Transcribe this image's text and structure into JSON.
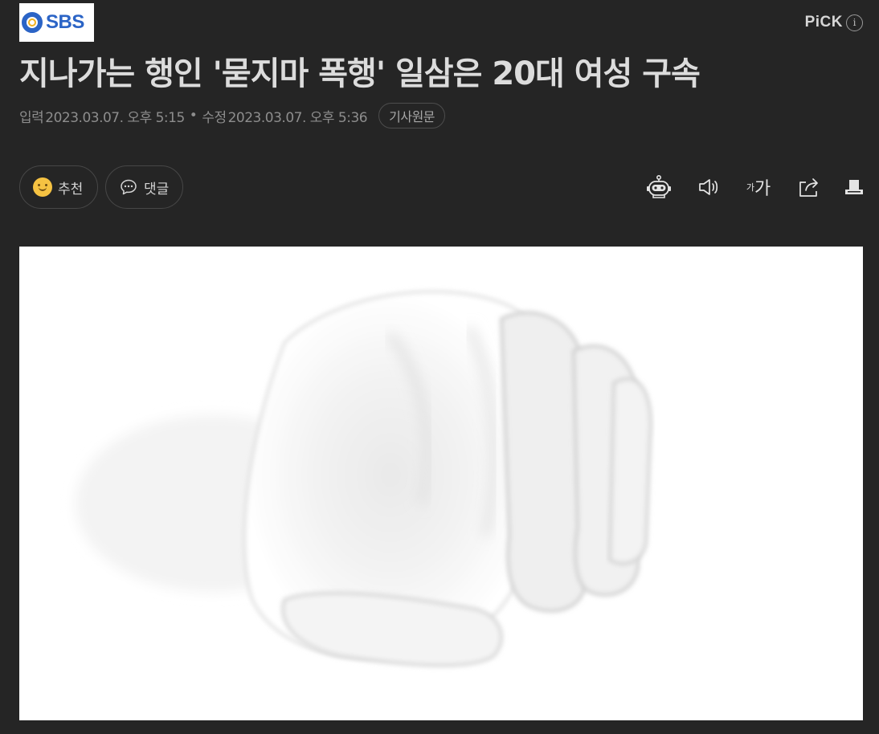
{
  "header": {
    "logo_text": "SBS",
    "pick_label": "PiCK",
    "pick_info": "i"
  },
  "article": {
    "title": "지나가는 행인 '묻지마 폭행' 일삼은 20대 여성 구속",
    "published_label": "입력",
    "published_at": "2023.03.07. 오후 5:15",
    "separator": "•",
    "modified_label": "수정",
    "modified_at": "2023.03.07. 오후 5:36",
    "original_button": "기사원문"
  },
  "actions": {
    "recommend_label": "추천",
    "comment_label": "댓글"
  },
  "toolbar": {
    "font_small": "가",
    "font_big": "가",
    "icons": [
      "summary-bot-icon",
      "speaker-icon",
      "font-size-icon",
      "share-icon",
      "print-icon"
    ]
  },
  "colors": {
    "background": "#252525",
    "title": "#dcdcdc",
    "meta": "#8d8d8d",
    "logo_blue": "#2b64c6",
    "logo_yellow": "#f2b01e"
  }
}
